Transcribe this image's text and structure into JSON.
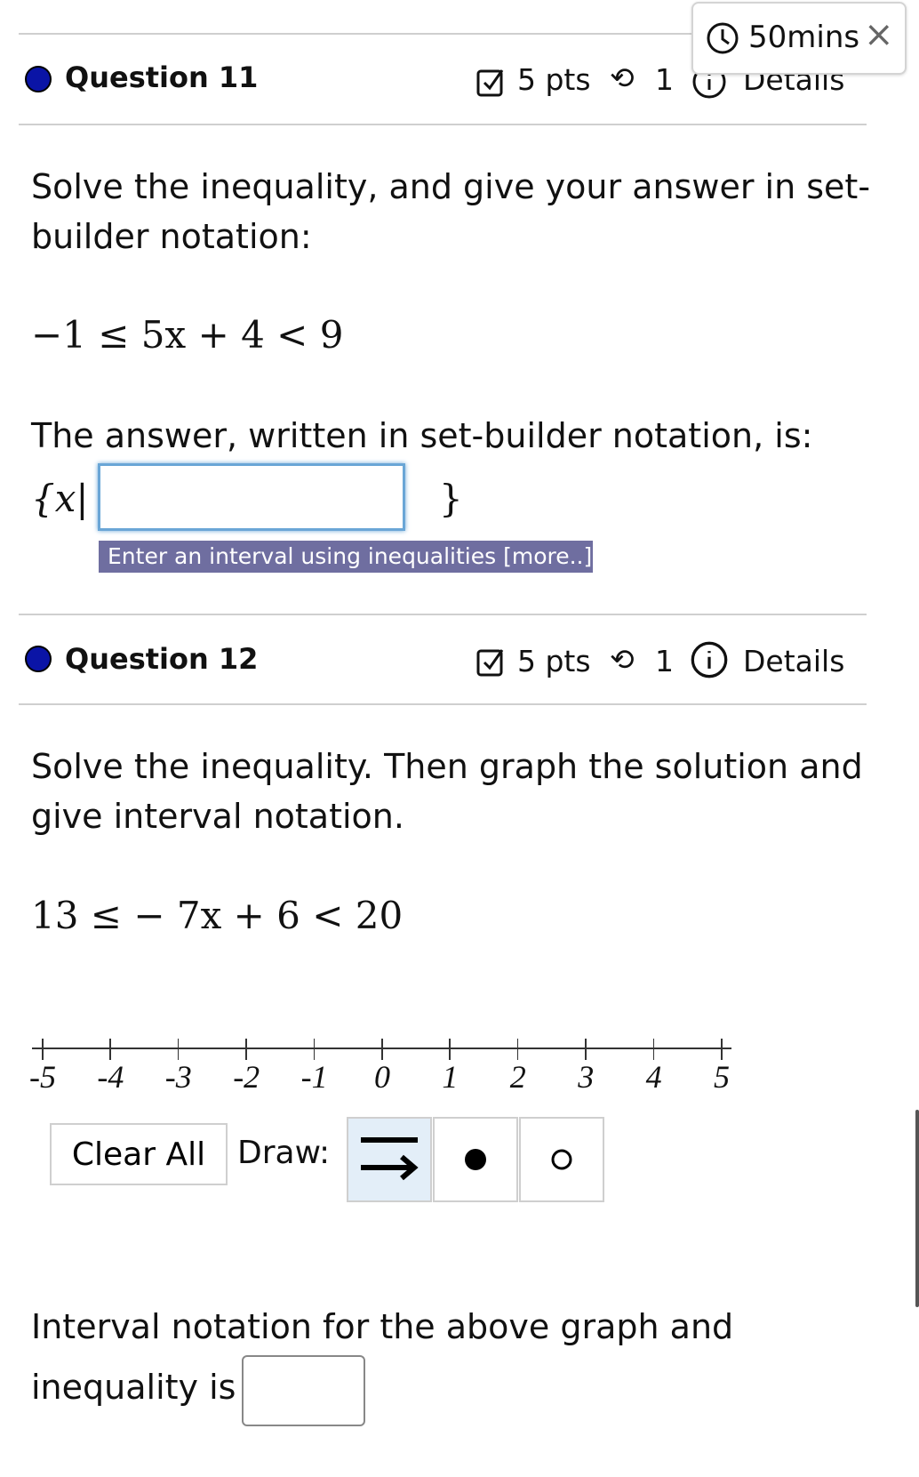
{
  "timer": {
    "text": "50mins",
    "clock_icon": "clock-icon",
    "close_icon": "close-icon"
  },
  "questions": [
    {
      "title": "Question 11",
      "points": "5 pts",
      "attempts": "1",
      "details": "Details",
      "prompt": "Solve the inequality, and give your answer in set-builder notation:",
      "prompt_lines": [
        "Solve the inequality, and give your answer in set-",
        "builder notation:"
      ],
      "math": "−1 ≤ 5x + 4 < 9",
      "answer_label": "The answer, written in set-builder notation, is:",
      "set_open": "{x|",
      "set_close": "}",
      "input_value": "",
      "tooltip": "Enter an interval using inequalities [more..]"
    },
    {
      "title": "Question 12",
      "points": "5 pts",
      "attempts": "1",
      "details": "Details",
      "prompt_lines": [
        "Solve the inequality. Then graph the solution and",
        "give interval notation."
      ],
      "math": "13 ≤ − 7x + 6 < 20",
      "number_line": {
        "ticks": [
          "-5",
          "-4",
          "-3",
          "-2",
          "-1",
          "0",
          "1",
          "2",
          "3",
          "4",
          "5"
        ]
      },
      "clear_all": "Clear All",
      "draw_label": "Draw:",
      "tools": [
        {
          "name": "ray",
          "selected": true
        },
        {
          "name": "closed-dot",
          "selected": false
        },
        {
          "name": "open-dot",
          "selected": false
        }
      ],
      "interval_lines": [
        "Interval notation for the above graph and",
        "inequality is"
      ],
      "interval_value": ""
    }
  ],
  "colors": {
    "dot": "#0a14a6",
    "tooltip_bg": "#6f6ea0",
    "selected_tool": "#e3eef8",
    "input_focus": "#6aa6d6"
  }
}
